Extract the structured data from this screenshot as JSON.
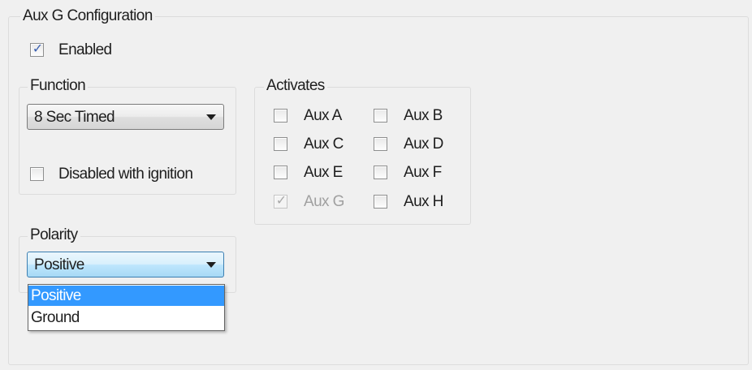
{
  "group": {
    "title": "Aux G Configuration"
  },
  "enabled": {
    "label": "Enabled",
    "checked": true
  },
  "function_group": {
    "title": "Function",
    "select_value": "8 Sec Timed",
    "disabled_with_ignition": {
      "label": "Disabled with ignition",
      "checked": false
    }
  },
  "activates": {
    "title": "Activates",
    "items": [
      {
        "label": "Aux A",
        "checked": false,
        "disabled": false
      },
      {
        "label": "Aux B",
        "checked": false,
        "disabled": false
      },
      {
        "label": "Aux C",
        "checked": false,
        "disabled": false
      },
      {
        "label": "Aux D",
        "checked": false,
        "disabled": false
      },
      {
        "label": "Aux E",
        "checked": false,
        "disabled": false
      },
      {
        "label": "Aux F",
        "checked": false,
        "disabled": false
      },
      {
        "label": "Aux G",
        "checked": true,
        "disabled": true
      },
      {
        "label": "Aux H",
        "checked": false,
        "disabled": false
      }
    ]
  },
  "polarity": {
    "title": "Polarity",
    "select_value": "Positive",
    "options": [
      "Positive",
      "Ground"
    ],
    "highlighted_option": "Positive"
  },
  "icons": {
    "check": "checkmark-icon",
    "dropdown": "chevron-down-icon"
  },
  "colors": {
    "selection": "#3399ff",
    "check": "#3a5fb0",
    "focus_border": "#3c7fb1"
  }
}
